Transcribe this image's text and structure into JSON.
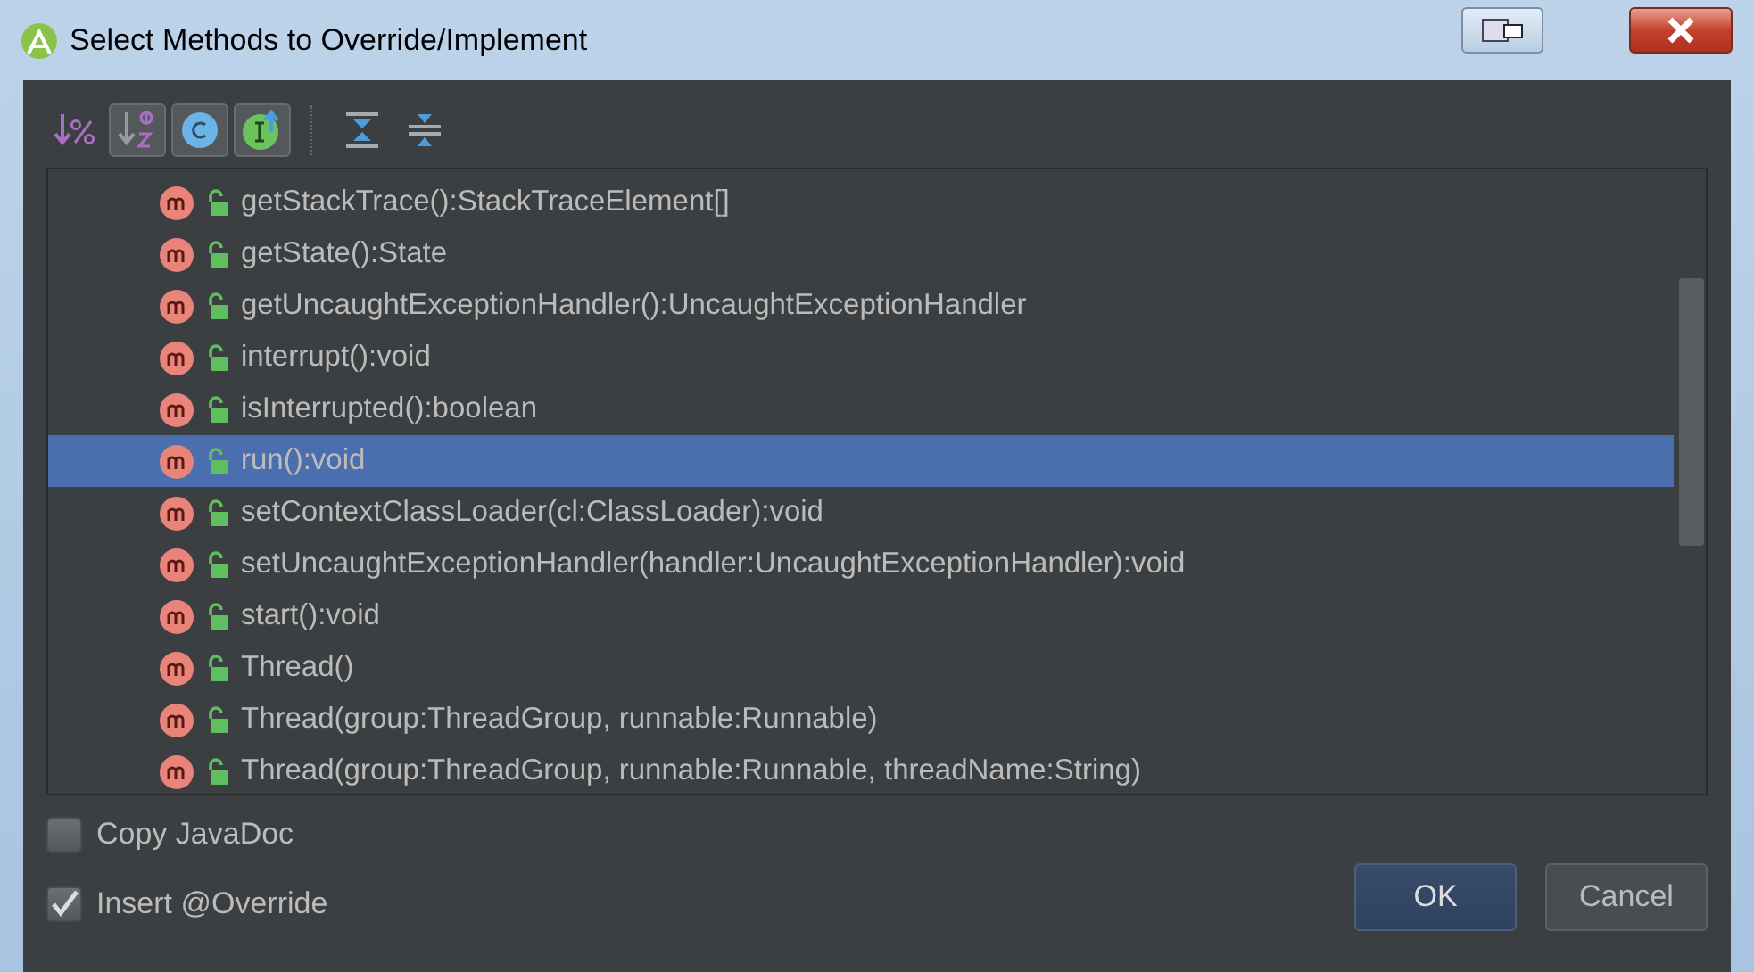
{
  "window": {
    "title": "Select Methods to Override/Implement"
  },
  "toolbar": [
    {
      "kind": "percent",
      "selected": false
    },
    {
      "kind": "sort",
      "selected": true
    },
    {
      "kind": "class",
      "selected": true
    },
    {
      "kind": "interface",
      "selected": true
    },
    {
      "kind": "expand",
      "selected": false
    },
    {
      "kind": "collapse",
      "selected": false
    }
  ],
  "methods": [
    {
      "label": "getStackTrace():StackTraceElement[]",
      "selected": false
    },
    {
      "label": "getState():State",
      "selected": false
    },
    {
      "label": "getUncaughtExceptionHandler():UncaughtExceptionHandler",
      "selected": false
    },
    {
      "label": "interrupt():void",
      "selected": false
    },
    {
      "label": "isInterrupted():boolean",
      "selected": false
    },
    {
      "label": "run():void",
      "selected": true
    },
    {
      "label": "setContextClassLoader(cl:ClassLoader):void",
      "selected": false
    },
    {
      "label": "setUncaughtExceptionHandler(handler:UncaughtExceptionHandler):void",
      "selected": false
    },
    {
      "label": "start():void",
      "selected": false
    },
    {
      "label": "Thread()",
      "selected": false
    },
    {
      "label": "Thread(group:ThreadGroup, runnable:Runnable)",
      "selected": false
    },
    {
      "label": "Thread(group:ThreadGroup, runnable:Runnable, threadName:String)",
      "selected": false
    }
  ],
  "options": [
    {
      "label": "Copy JavaDoc",
      "checked": false
    },
    {
      "label": "Insert @Override",
      "checked": true
    }
  ],
  "buttons": [
    {
      "label": "OK",
      "kind": "default"
    },
    {
      "label": "Cancel",
      "kind": "normal"
    }
  ]
}
